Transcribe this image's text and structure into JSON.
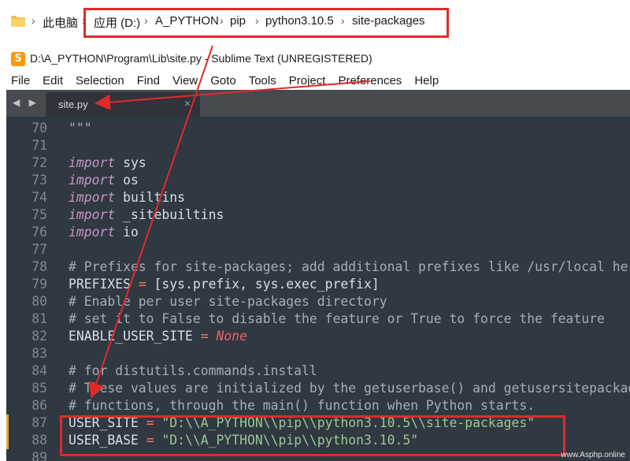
{
  "explorer": {
    "crumbs": [
      "此电脑",
      "应用 (D:)",
      "A_PYTHON",
      "pip",
      "python3.10.5",
      "site-packages"
    ]
  },
  "window": {
    "icon_letter": "S",
    "title": "D:\\A_PYTHON\\Program\\Lib\\site.py - Sublime Text (UNREGISTERED)"
  },
  "menu": [
    "File",
    "Edit",
    "Selection",
    "Find",
    "View",
    "Goto",
    "Tools",
    "Project",
    "Preferences",
    "Help"
  ],
  "tabs": {
    "nav_arrows": "◀ ▶",
    "active_tab": "site.py",
    "close_glyph": "×"
  },
  "editor": {
    "lines": [
      {
        "n": "70",
        "tokens": [
          [
            "cm",
            "\"\"\""
          ]
        ]
      },
      {
        "n": "71",
        "tokens": []
      },
      {
        "n": "72",
        "tokens": [
          [
            "kw",
            "import"
          ],
          [
            "",
            " sys"
          ]
        ]
      },
      {
        "n": "73",
        "tokens": [
          [
            "kw",
            "import"
          ],
          [
            "",
            " os"
          ]
        ]
      },
      {
        "n": "74",
        "tokens": [
          [
            "kw",
            "import"
          ],
          [
            "",
            " builtins"
          ]
        ]
      },
      {
        "n": "75",
        "tokens": [
          [
            "kw",
            "import"
          ],
          [
            "",
            " _sitebuiltins"
          ]
        ]
      },
      {
        "n": "76",
        "tokens": [
          [
            "kw",
            "import"
          ],
          [
            "",
            " io"
          ]
        ]
      },
      {
        "n": "77",
        "tokens": []
      },
      {
        "n": "78",
        "tokens": [
          [
            "cm",
            "# Prefixes for site-packages; add additional prefixes like /usr/local here"
          ]
        ]
      },
      {
        "n": "79",
        "tokens": [
          [
            "",
            "PREFIXES "
          ],
          [
            "op",
            "="
          ],
          [
            "",
            " [sys.prefix, sys.exec_prefix]"
          ]
        ]
      },
      {
        "n": "80",
        "tokens": [
          [
            "cm",
            "# Enable per user site-packages directory"
          ]
        ]
      },
      {
        "n": "81",
        "tokens": [
          [
            "cm",
            "# set it to False to disable the feature or True to force the feature"
          ]
        ]
      },
      {
        "n": "82",
        "tokens": [
          [
            "",
            "ENABLE_USER_SITE "
          ],
          [
            "op",
            "="
          ],
          [
            "",
            " "
          ],
          [
            "nn",
            "None"
          ]
        ]
      },
      {
        "n": "83",
        "tokens": []
      },
      {
        "n": "84",
        "tokens": [
          [
            "cm",
            "# for distutils.commands.install"
          ]
        ]
      },
      {
        "n": "85",
        "tokens": [
          [
            "cm",
            "# These values are initialized by the getuserbase() and getusersitepackages()"
          ]
        ]
      },
      {
        "n": "86",
        "tokens": [
          [
            "cm",
            "# functions, through the main() function when Python starts."
          ]
        ]
      },
      {
        "n": "87",
        "tokens": [
          [
            "",
            "USER_SITE "
          ],
          [
            "op",
            "="
          ],
          [
            "",
            " "
          ],
          [
            "st",
            "\"D:\\\\A_PYTHON\\\\pip\\\\python3.10.5\\\\site-packages\""
          ]
        ]
      },
      {
        "n": "88",
        "tokens": [
          [
            "",
            "USER_BASE "
          ],
          [
            "op",
            "="
          ],
          [
            "",
            " "
          ],
          [
            "st",
            "\"D:\\\\A_PYTHON\\\\pip\\\\python3.10.5\""
          ]
        ]
      },
      {
        "n": "89",
        "tokens": []
      }
    ]
  },
  "watermark": "www.Asphp.online",
  "colors": {
    "editor_bg": "#303841",
    "keyword": "#c695c6",
    "comment": "#a6acb9",
    "operator": "#f97b58",
    "string": "#99c794",
    "constant": "#ec5f66",
    "annotation": "#e02a2a",
    "modified_marker": "#e2a83b"
  }
}
